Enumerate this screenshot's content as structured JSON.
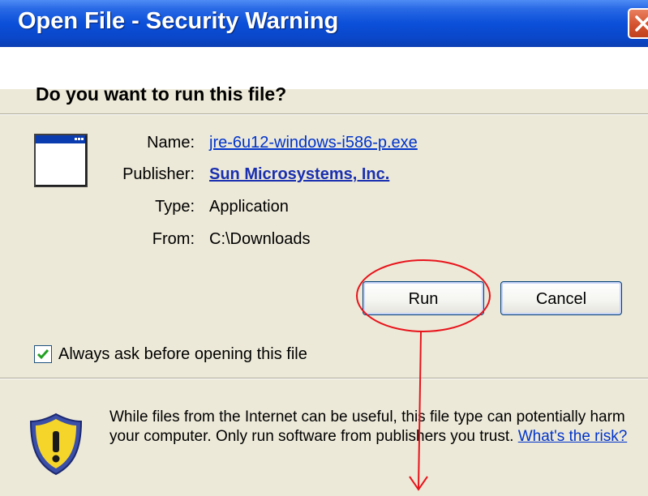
{
  "dialog": {
    "title": "Open File - Security Warning",
    "question": "Do you want to run this file?"
  },
  "fields": {
    "name_label": "Name:",
    "name_value": "jre-6u12-windows-i586-p.exe",
    "publisher_label": "Publisher:",
    "publisher_value": "Sun Microsystems, Inc.",
    "type_label": "Type:",
    "type_value": "Application",
    "from_label": "From:",
    "from_value": "C:\\Downloads"
  },
  "buttons": {
    "run_label": "Run",
    "cancel_label": "Cancel"
  },
  "checkbox": {
    "label": "Always ask before opening this file",
    "checked": true
  },
  "warning": {
    "text": "While files from the Internet can be useful, this file type can potentially harm your computer. Only run software from publishers you trust.",
    "link": "What's the risk?"
  },
  "icons": {
    "close": "close-icon",
    "app": "application-window-icon",
    "shield": "warning-shield-icon",
    "check": "checkmark-icon"
  },
  "colors": {
    "title_bar": "#0b4fd9",
    "dialog_bg": "#ece9d8",
    "link": "#0033cc",
    "annotation": "#e8131b"
  }
}
